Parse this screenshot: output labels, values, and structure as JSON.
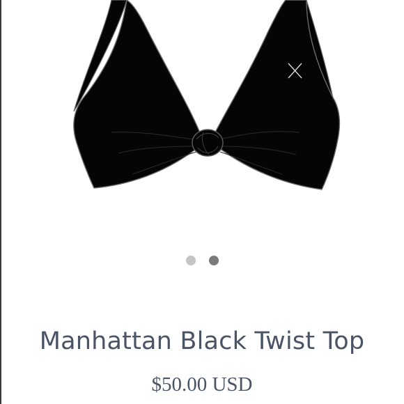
{
  "product": {
    "image_icon": "bikini-top-image",
    "image_colors": {
      "garment": "#050505",
      "outline": "#6a6a6a",
      "background": "#ffffff"
    },
    "watermark_icon": "close-x-icon",
    "title": "Manhattan Black Twist Top",
    "price": "$50.00 USD"
  },
  "carousel": {
    "total_slides": 2,
    "active_index": 1,
    "dot_colors": {
      "inactive": "#c4c4c4",
      "active": "#7a7a7a"
    }
  }
}
